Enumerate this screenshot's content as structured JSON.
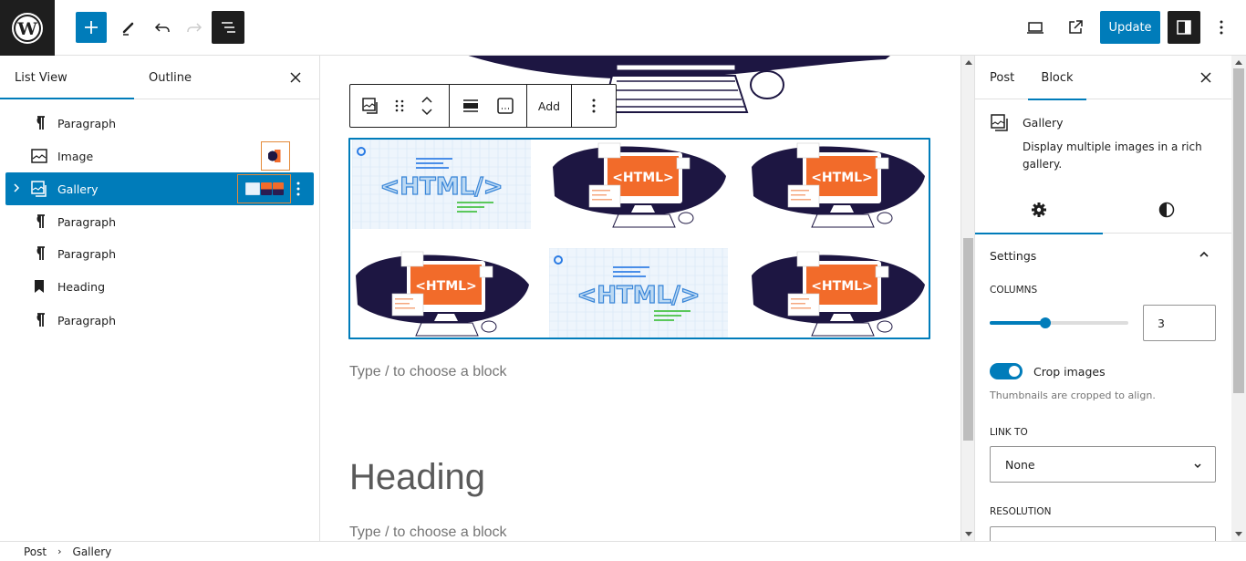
{
  "header": {
    "logo": "wordpress-logo",
    "update_label": "Update",
    "icons": [
      "plus-icon",
      "pencil-icon",
      "undo-icon",
      "redo-icon",
      "list-view-icon",
      "desktop-preview-icon",
      "external-link-icon",
      "sidebar-icon",
      "more-vertical-icon"
    ]
  },
  "left_panel": {
    "tabs": [
      {
        "label": "List View",
        "active": true
      },
      {
        "label": "Outline",
        "active": false
      }
    ],
    "items": [
      {
        "label": "Paragraph",
        "icon": "paragraph-icon"
      },
      {
        "label": "Image",
        "icon": "image-icon"
      },
      {
        "label": "Gallery",
        "icon": "gallery-icon",
        "selected": true
      },
      {
        "label": "Paragraph",
        "icon": "paragraph-icon"
      },
      {
        "label": "Paragraph",
        "icon": "paragraph-icon"
      },
      {
        "label": "Heading",
        "icon": "heading-bookmark-icon"
      },
      {
        "label": "Paragraph",
        "icon": "paragraph-icon"
      }
    ]
  },
  "canvas": {
    "toolbar": {
      "add_label": "Add"
    },
    "gallery": {
      "columns": 3,
      "images": [
        {
          "type": "html-banner",
          "text": "<HTML/>"
        },
        {
          "type": "html-computer",
          "text": "<HTML>"
        },
        {
          "type": "html-computer",
          "text": "<HTML>"
        },
        {
          "type": "html-computer",
          "text": "<HTML>"
        },
        {
          "type": "html-banner",
          "text": "<HTML/>"
        },
        {
          "type": "html-computer",
          "text": "<HTML>"
        }
      ]
    },
    "placeholder_1": "Type / to choose a block",
    "heading": "Heading",
    "placeholder_2": "Type / to choose a block"
  },
  "right_panel": {
    "tabs": [
      {
        "label": "Post",
        "active": false
      },
      {
        "label": "Block",
        "active": true
      }
    ],
    "block": {
      "title": "Gallery",
      "description": "Display multiple images in a rich gallery."
    },
    "settings": {
      "title": "Settings",
      "columns_label": "Columns",
      "columns_value": "3",
      "columns_slider_fraction": 0.4,
      "crop_label": "Crop images",
      "crop_on": true,
      "crop_help": "Thumbnails are cropped to align.",
      "link_to_label": "Link to",
      "link_to_value": "None",
      "resolution_label": "Resolution"
    }
  },
  "footer": {
    "breadcrumb": [
      "Post",
      "Gallery"
    ]
  },
  "colors": {
    "accent": "#007cba",
    "dark": "#1e1e1e",
    "thumb_border": "#e48a3a"
  }
}
